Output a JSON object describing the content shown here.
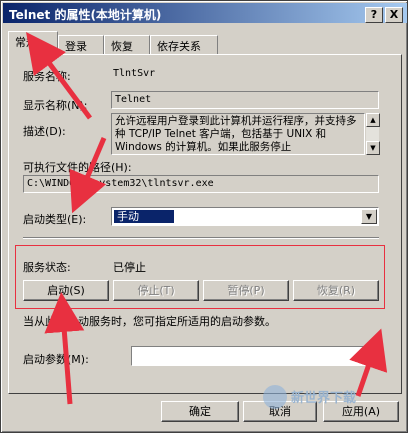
{
  "window": {
    "title": "Telnet 的属性(本地计算机)",
    "help_btn": "?",
    "close_btn": "X"
  },
  "tabs": [
    "常规",
    "登录",
    "恢复",
    "依存关系"
  ],
  "general": {
    "service_name_label": "服务名称:",
    "service_name_value": "TlntSvr",
    "display_name_label": "显示名称(N):",
    "display_name_value": "Telnet",
    "description_label": "描述(D):",
    "description_value": "允许远程用户登录到此计算机并运行程序，并支持多种 TCP/IP Telnet 客户端，包括基于 UNIX 和 Windows 的计算机。如果此服务停止",
    "path_label": "可执行文件的路径(H):",
    "path_value": "C:\\WINDOWS\\system32\\tlntsvr.exe",
    "startup_type_label": "启动类型(E):",
    "startup_type_value": "手动",
    "service_status_label": "服务状态:",
    "service_status_value": "已停止",
    "start_btn": "启动(S)",
    "stop_btn": "停止(T)",
    "pause_btn": "暂停(P)",
    "resume_btn": "恢复(R)",
    "hint_text": "当从此处启动服务时，您可指定所适用的启动参数。",
    "start_params_label": "启动参数(M):",
    "start_params_value": ""
  },
  "footer": {
    "ok_btn": "确定",
    "cancel_btn": "取消",
    "apply_btn": "应用(A)"
  },
  "watermark": "新世界下载",
  "colors": {
    "title_gradient_start": "#0a246a",
    "title_gradient_end": "#a6caf0",
    "face": "#d4d0c8",
    "highlight_box": "#e83040",
    "arrow": "#e83040"
  }
}
